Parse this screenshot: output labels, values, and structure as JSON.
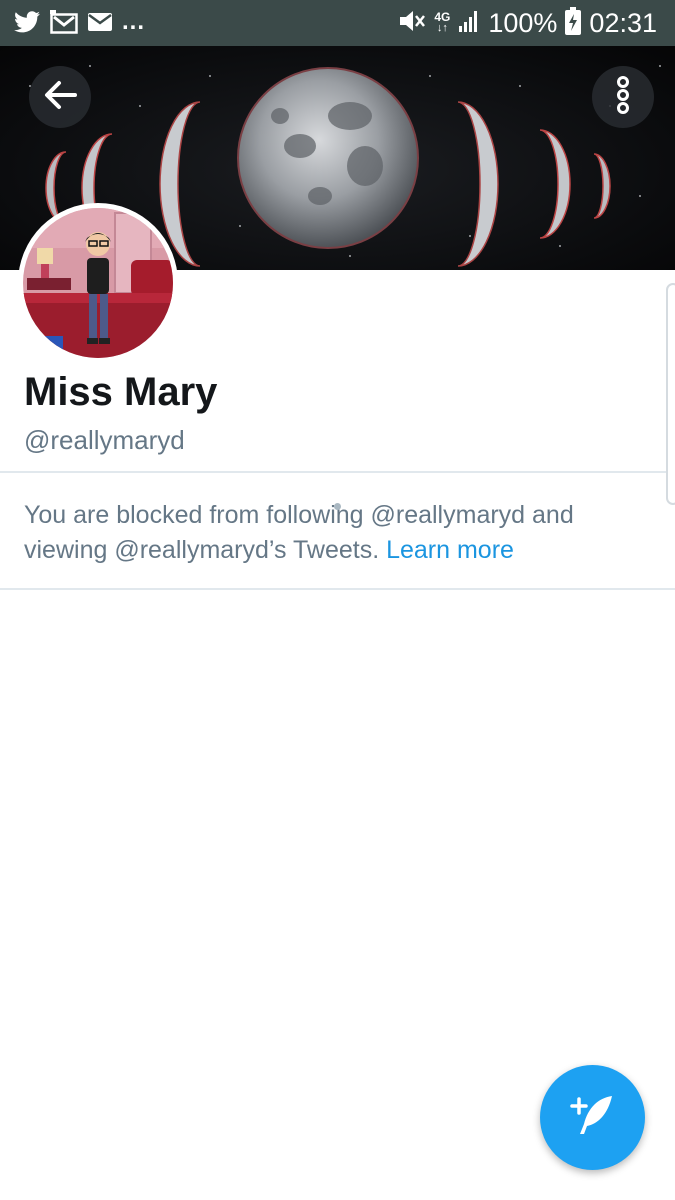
{
  "status_bar": {
    "icons_left": [
      "twitter-icon",
      "gmail-icon",
      "email-icon"
    ],
    "more_label": "...",
    "icons_right": [
      "mute-icon",
      "network-4g-icon",
      "signal-icon",
      "battery-charging-icon"
    ],
    "network_label": "4G",
    "battery": "100%",
    "time": "02:31"
  },
  "header": {
    "back_icon": "arrow-left-icon",
    "more_icon": "more-vertical-icon"
  },
  "profile": {
    "name": "Miss Mary",
    "handle": "@reallymaryd"
  },
  "blocked_notice": {
    "text": "You are blocked from following @reallymaryd and viewing @reallymaryd’s Tweets.",
    "link_label": "Learn more"
  },
  "fab": {
    "icon": "compose-tweet-icon"
  },
  "colors": {
    "status_bar_bg": "#3b4a49",
    "name_text": "#14171a",
    "secondary_text": "#657786",
    "link": "#1b95e0",
    "fab": "#1da1f2"
  }
}
